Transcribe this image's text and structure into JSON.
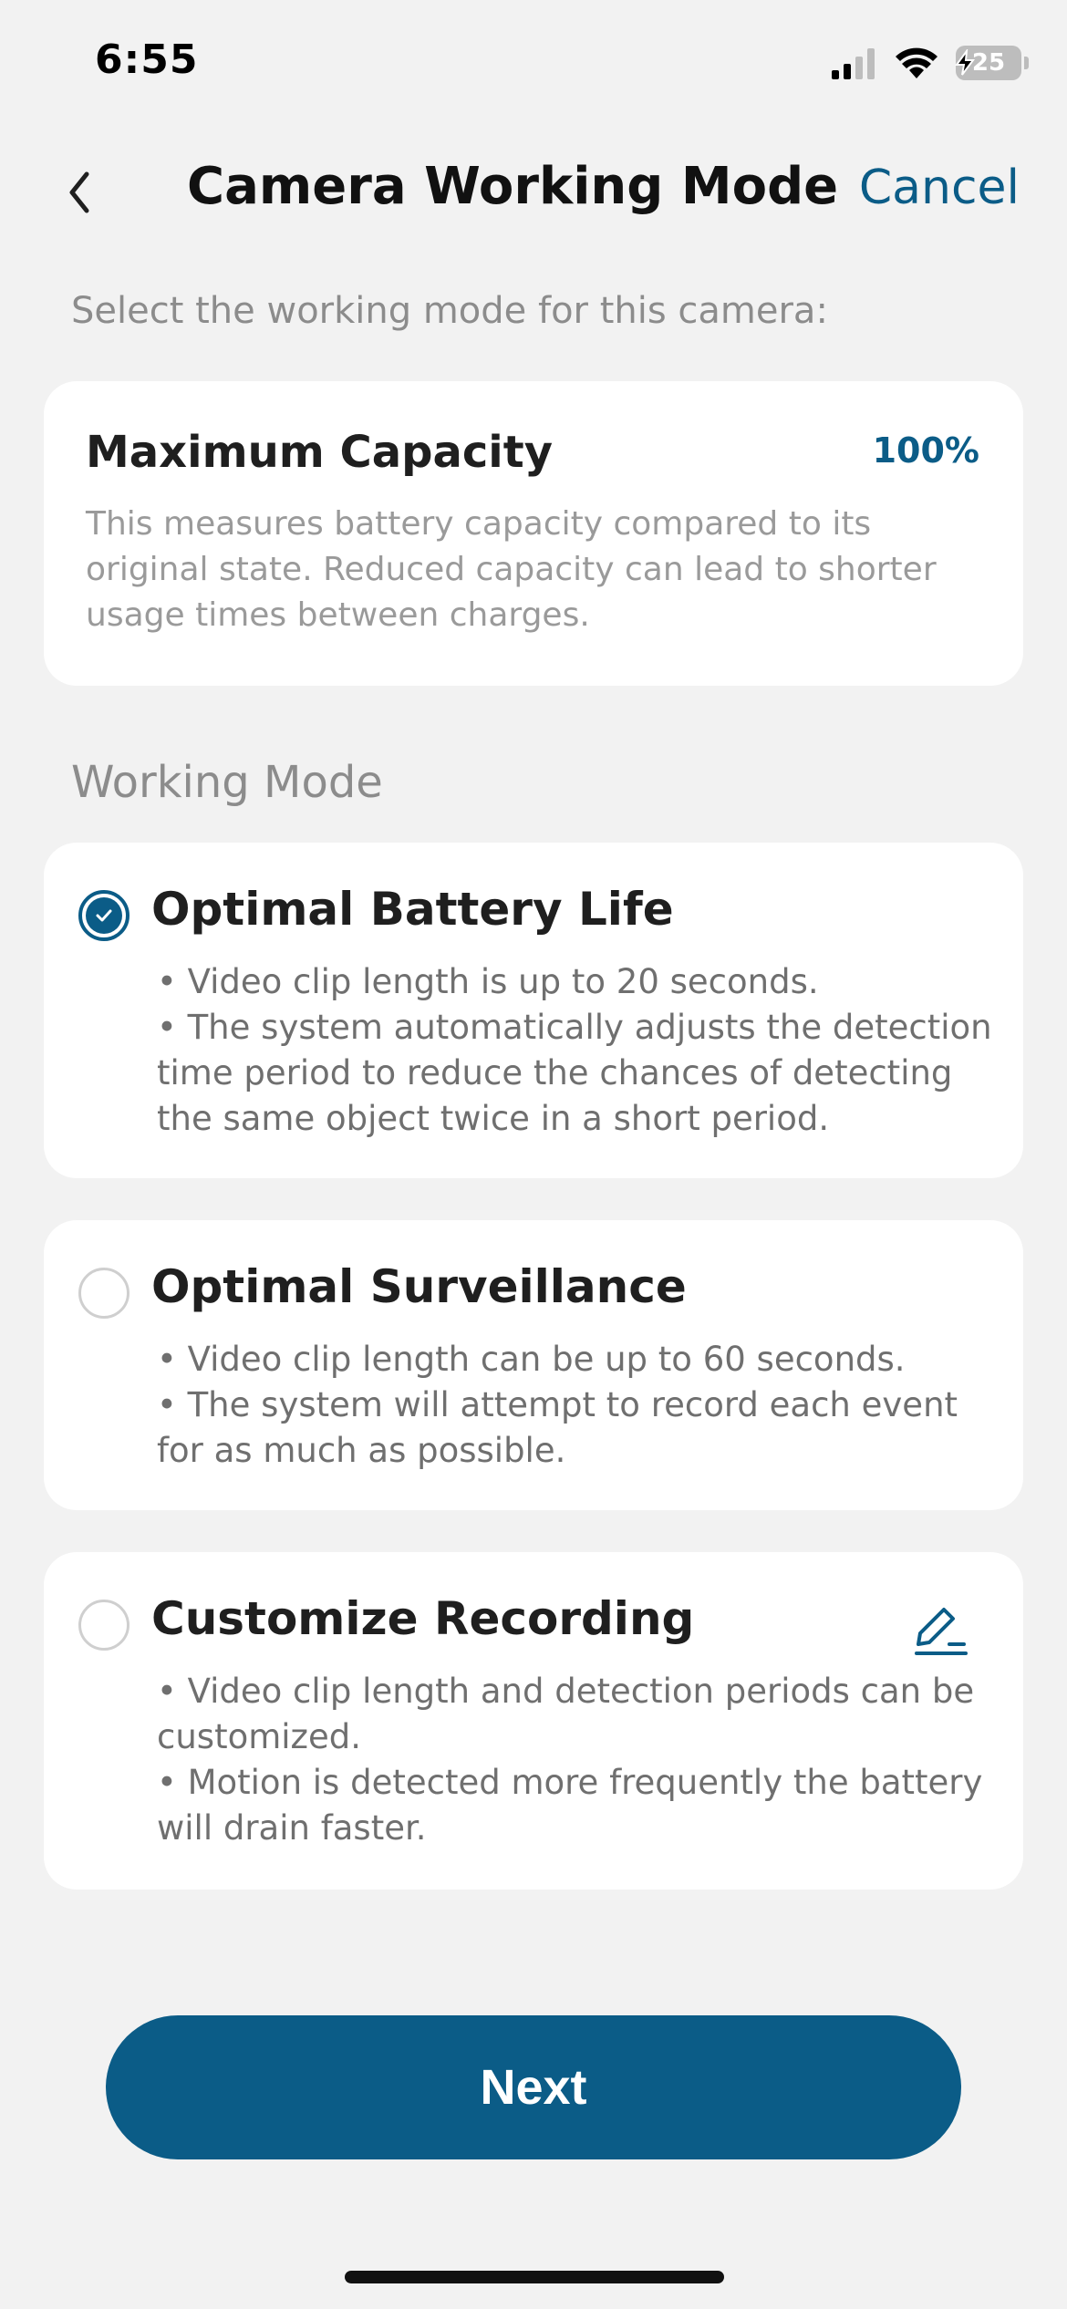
{
  "status_bar": {
    "time": "6:55",
    "battery_level": "25",
    "icons": [
      "cellular-signal-icon",
      "wifi-icon",
      "battery-icon"
    ]
  },
  "header": {
    "title": "Camera Working Mode",
    "cancel_label": "Cancel",
    "back_icon": "chevron-left-icon"
  },
  "intro": "Select the working mode for this camera:",
  "capacity_card": {
    "title": "Maximum Capacity",
    "value": "100%",
    "description": "This measures battery capacity compared to its original state. Reduced capacity can lead to shorter usage times between charges."
  },
  "working_mode": {
    "label": "Working Mode",
    "selected": "Optimal Battery Life",
    "options": [
      {
        "title": "Optimal Battery Life",
        "selected": true,
        "bullets": [
          "• Video clip length is up to 20 seconds.",
          "• The system automatically adjusts the detection time period to reduce the chances of detecting the same object twice in a short period."
        ]
      },
      {
        "title": "Optimal Surveillance",
        "selected": false,
        "bullets": [
          "• Video clip length can be up to 60 seconds.",
          "• The system will attempt to record each event for as much as possible."
        ]
      },
      {
        "title": "Customize Recording",
        "selected": false,
        "edit_icon": "edit-pencil-icon",
        "bullets": [
          "• Video clip length and detection periods can be customized.",
          "• Motion is detected more frequently the battery will drain faster."
        ]
      }
    ]
  },
  "footer": {
    "next_label": "Next"
  },
  "colors": {
    "accent": "#0b5c87",
    "background": "#f2f2f2",
    "card": "#ffffff",
    "muted_text": "#8c8c8c"
  }
}
